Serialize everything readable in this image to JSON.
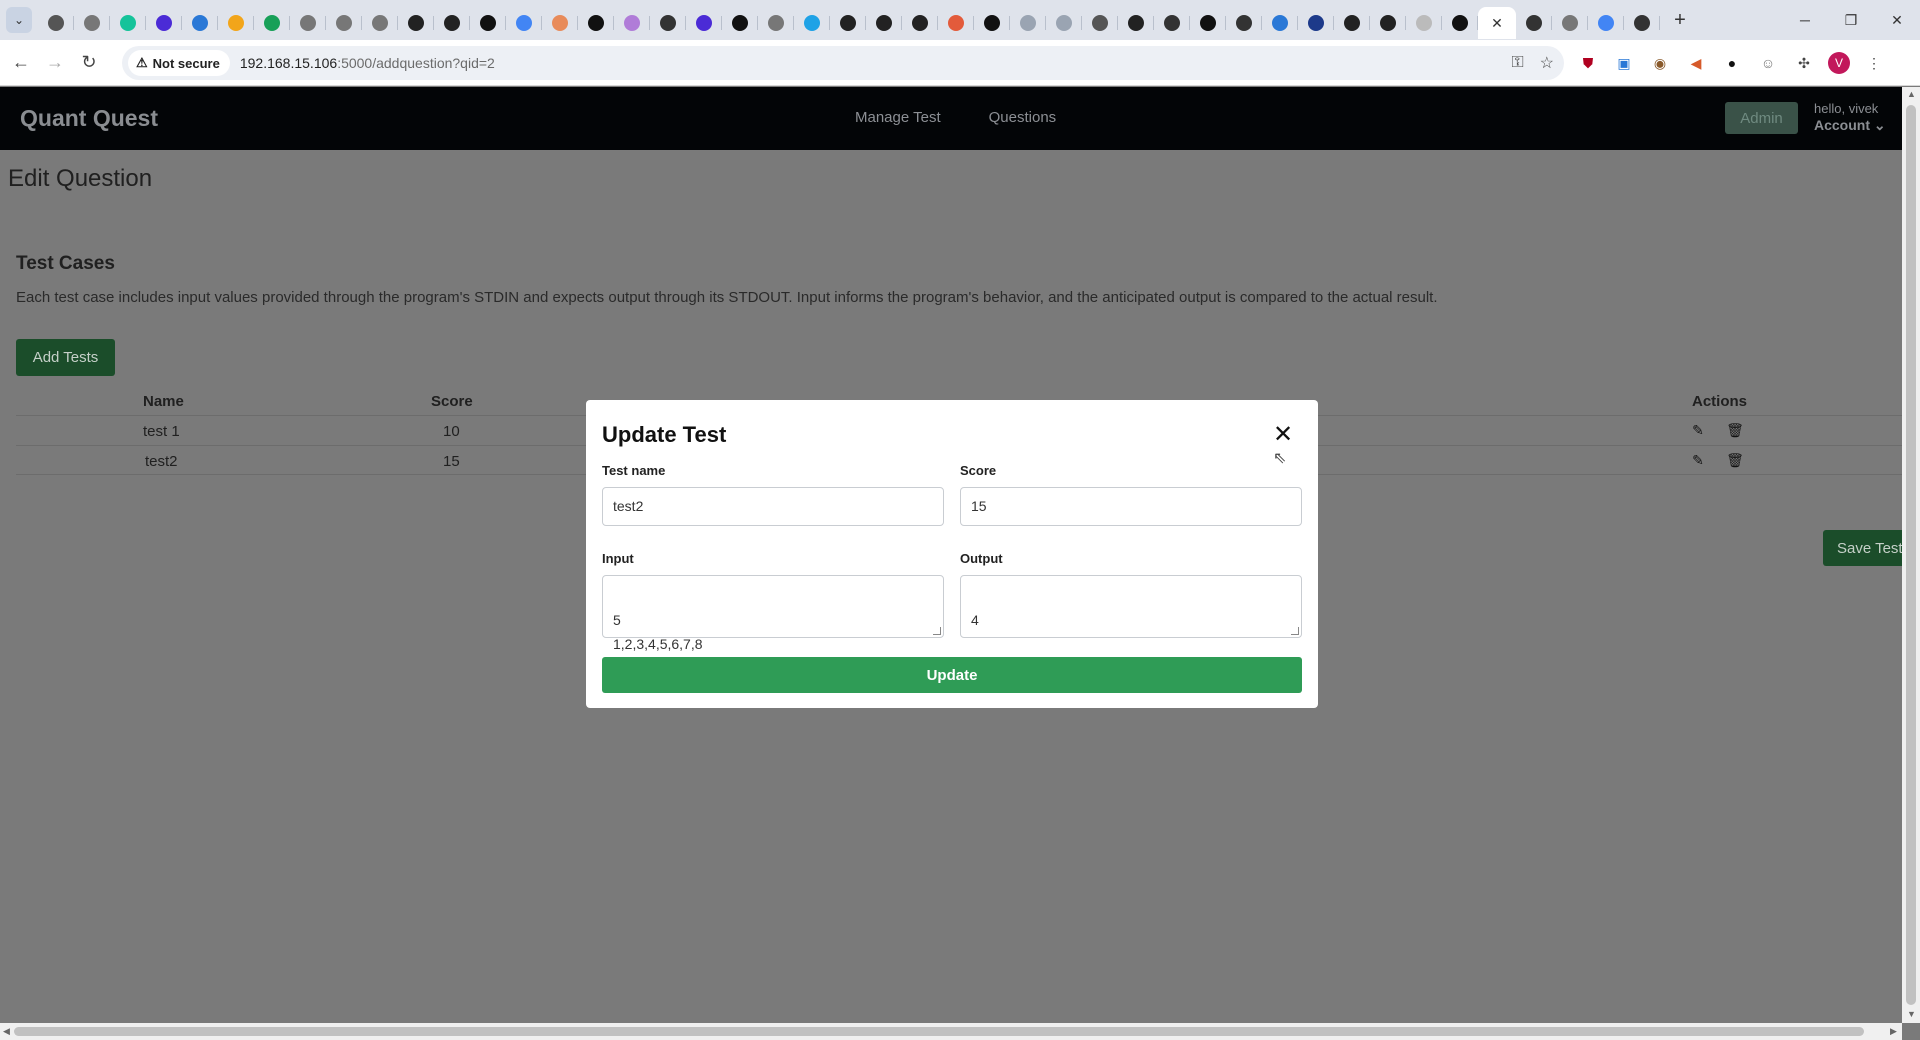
{
  "browser": {
    "security_label": "Not secure",
    "url_host": "192.168.15.106",
    "url_rest": ":5000/addquestion?qid=2",
    "tab_favicons": [
      {
        "icon": "chatgpt-icon",
        "color": "#555555"
      },
      {
        "icon": "generic-site-icon",
        "color": "#777777"
      },
      {
        "icon": "grammarly-icon",
        "color": "#15c39a"
      },
      {
        "icon": "claude-icon",
        "color": "#4b2bd6"
      },
      {
        "icon": "refresh-site-icon",
        "color": "#2a78d6"
      },
      {
        "icon": "folder-icon",
        "color": "#f2a51a"
      },
      {
        "icon": "n-icon",
        "color": "#18a058"
      },
      {
        "icon": "generic-site-icon",
        "color": "#777777"
      },
      {
        "icon": "generic-site-icon",
        "color": "#777777"
      },
      {
        "icon": "generic-site-icon",
        "color": "#777777"
      },
      {
        "icon": "github-icon",
        "color": "#222222"
      },
      {
        "icon": "github-icon",
        "color": "#222222"
      },
      {
        "icon": "a-icon",
        "color": "#111111"
      },
      {
        "icon": "google-icon",
        "color": "#4285f4"
      },
      {
        "icon": "pin-icon",
        "color": "#e88b5a"
      },
      {
        "icon": "medium-icon",
        "color": "#111111"
      },
      {
        "icon": "puzzle-site-icon",
        "color": "#b07cd8"
      },
      {
        "icon": "openai-icon",
        "color": "#333333"
      },
      {
        "icon": "claude-icon",
        "color": "#4b2bd6"
      },
      {
        "icon": "x-icon",
        "color": "#111111"
      },
      {
        "icon": "generic-site-icon",
        "color": "#777777"
      },
      {
        "icon": "chat-icon",
        "color": "#1fa2e6"
      },
      {
        "icon": "github-icon",
        "color": "#222222"
      },
      {
        "icon": "github-icon",
        "color": "#222222"
      },
      {
        "icon": "github-icon",
        "color": "#222222"
      },
      {
        "icon": "calendar-icon",
        "color": "#e35b3b"
      },
      {
        "icon": "square-icon",
        "color": "#111111"
      },
      {
        "icon": "wave-icon",
        "color": "#9aa4b2"
      },
      {
        "icon": "wave-icon",
        "color": "#9aa4b2"
      },
      {
        "icon": "chatgpt-icon",
        "color": "#555555"
      },
      {
        "icon": "github-icon",
        "color": "#222222"
      },
      {
        "icon": "paw-icon",
        "color": "#333333"
      },
      {
        "icon": "x-icon",
        "color": "#111111"
      },
      {
        "icon": "openai-icon",
        "color": "#333333"
      },
      {
        "icon": "globe-icon",
        "color": "#2a78d6"
      },
      {
        "icon": "hex-icon",
        "color": "#1d3a8a"
      },
      {
        "icon": "github-icon",
        "color": "#222222"
      },
      {
        "icon": "github-icon",
        "color": "#222222"
      },
      {
        "icon": "doc-icon",
        "color": "#bbbbbb"
      },
      {
        "icon": "ms-icon",
        "color": "#111111"
      }
    ],
    "tabs_after_active": [
      {
        "icon": "openai-icon",
        "color": "#333333"
      },
      {
        "icon": "generic-site-icon",
        "color": "#777777"
      },
      {
        "icon": "google-icon",
        "color": "#4285f4"
      },
      {
        "icon": "openai-icon",
        "color": "#333333"
      }
    ],
    "profile_initial": "V"
  },
  "app": {
    "brand": "Quant Quest",
    "nav": {
      "manage_test": "Manage Test",
      "questions": "Questions"
    },
    "admin_label": "Admin",
    "greeting": "hello, vivek",
    "account_label": "Account"
  },
  "page": {
    "title": "Edit Question",
    "section_title": "Test Cases",
    "section_desc": "Each test case includes input values provided through the program's STDIN and expects output through its STDOUT. Input informs the program's behavior, and the anticipated output is compared to the actual result.",
    "add_tests_label": "Add Tests",
    "save_tests_label": "Save Tests",
    "table": {
      "headers": {
        "name": "Name",
        "score": "Score",
        "actions": "Actions"
      },
      "rows": [
        {
          "name": "test 1",
          "score": "10"
        },
        {
          "name": "test2",
          "score": "15"
        }
      ]
    }
  },
  "modal": {
    "title": "Update Test",
    "labels": {
      "name": "Test name",
      "score": "Score",
      "input": "Input",
      "output": "Output"
    },
    "values": {
      "name": "test2",
      "score": "15",
      "input": "5\n1,2,3,4,5,6,7,8",
      "output": "4"
    },
    "update_label": "Update"
  }
}
